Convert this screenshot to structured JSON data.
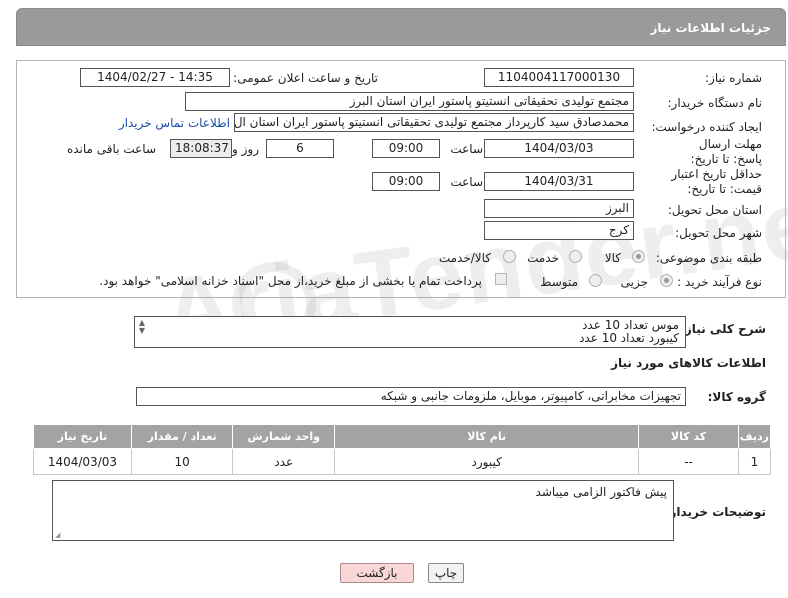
{
  "header": {
    "title": "جزئیات اطلاعات نیاز"
  },
  "form": {
    "need_number_label": "شماره نیاز:",
    "need_number": "1104004117000130",
    "announce_label": "تاریخ و ساعت اعلان عمومی:",
    "announce_value": "1404/02/27 - 14:35",
    "buyer_org_label": "نام دستگاه خریدار:",
    "buyer_org": "مجتمع تولیدی تحقیقاتی انستیتو پاستور ایران استان البرز",
    "creator_label": "ایجاد کننده درخواست:",
    "creator": "محمدصادق سید کارپرداز مجتمع تولیدی تحقیقاتی انستیتو پاستور ایران استان ال",
    "contact_link": "اطلاعات تماس خریدار",
    "reply_deadline_label": "مهلت ارسال پاسخ: تا تاریخ:",
    "reply_date": "1404/03/03",
    "time_label": "ساعت",
    "reply_time": "09:00",
    "days_value": "6",
    "days_label": "روز و",
    "remaining_time": "18:08:37",
    "remaining_label": "ساعت باقی مانده",
    "price_validity_label": "حداقل تاریخ اعتبار قیمت: تا تاریخ:",
    "validity_date": "1404/03/31",
    "validity_time": "09:00",
    "province_label": "استان محل تحویل:",
    "province": "البرز",
    "city_label": "شهر محل تحویل:",
    "city": "کرج",
    "category_label": "طبقه بندی موضوعی:",
    "category_options": [
      "کالا",
      "خدمت",
      "کالا/خدمت"
    ],
    "process_label": "نوع فرآیند خرید :",
    "process_options": [
      "جزیی",
      "متوسط"
    ],
    "payment_note": "پرداخت تمام یا بخشی از مبلغ خرید،از محل \"اسناد خزانه اسلامی\" خواهد بود."
  },
  "watermark": "AriaTender.neT",
  "general_desc": {
    "label": "شرح کلی نیاز:",
    "line1": "موس تعداد 10 عدد",
    "line2": "کیبورد تعداد 10 عدد"
  },
  "goods": {
    "section_title": "اطلاعات کالاهای مورد نیاز",
    "group_label": "گروه کالا:",
    "group_value": "تجهیزات مخابراتی، کامپیوتر، موبایل، ملزومات جانبی و شبکه",
    "columns": [
      "ردیف",
      "کد کالا",
      "نام کالا",
      "واحد شمارش",
      "تعداد / مقدار",
      "تاریخ نیاز"
    ],
    "rows": [
      {
        "row": "1",
        "code": "--",
        "name": "کیبورد",
        "unit": "عدد",
        "qty": "10",
        "date": "1404/03/03"
      }
    ]
  },
  "notes": {
    "label": "توضیحات خریدار:",
    "text": "پیش فاکتور الزامی میباشد"
  },
  "buttons": {
    "print": "چاپ",
    "back": "بازگشت"
  },
  "colors": {
    "header_bg": "#9a9a9a",
    "link": "#1a4fa8",
    "back_button_bg": "#f9d7d7"
  }
}
